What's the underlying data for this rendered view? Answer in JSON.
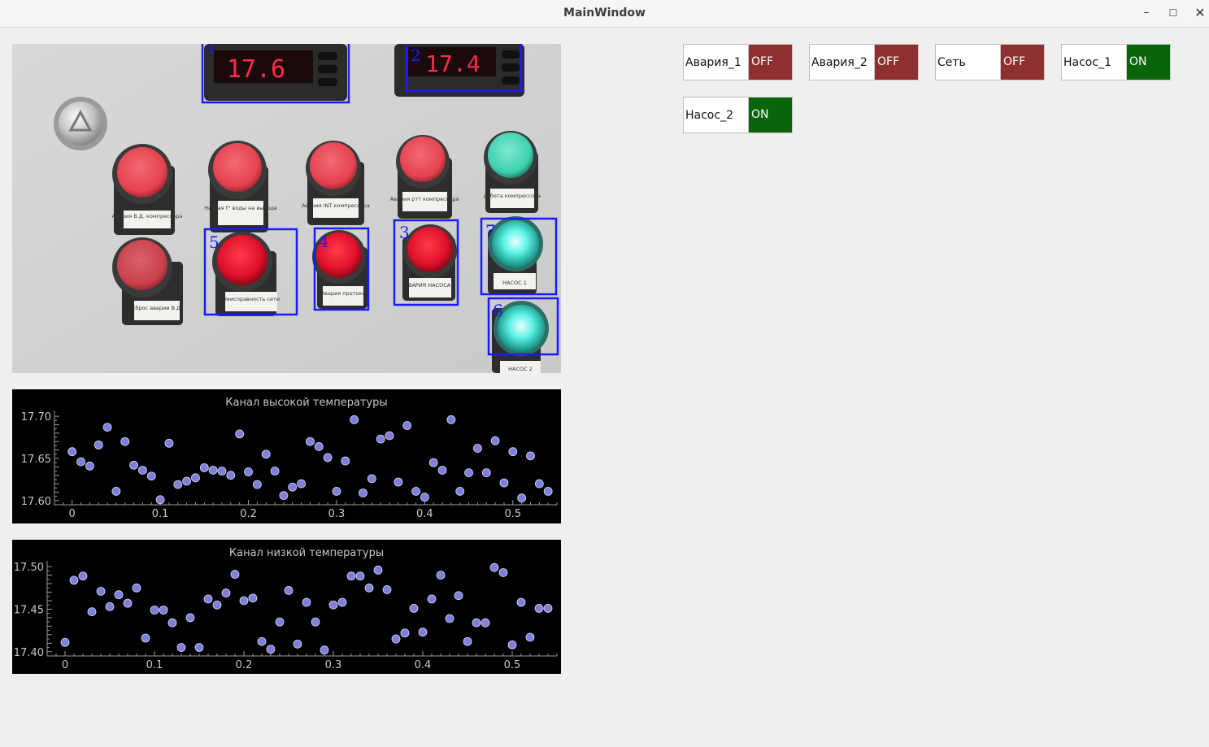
{
  "window": {
    "title": "MainWindow",
    "controls": {
      "minimize": "–",
      "maximize": "☐",
      "close": "✕"
    }
  },
  "camera": {
    "detections": [
      {
        "label": "1"
      },
      {
        "label": "2"
      },
      {
        "label": "3"
      },
      {
        "label": "4"
      },
      {
        "label": "5"
      },
      {
        "label": "6"
      },
      {
        "label": "7"
      }
    ],
    "display_readings": [
      "17.6",
      "17.4"
    ],
    "lamp_captions": [
      "Авария В.Д. компрессора",
      "Низкая t° воды на выходе",
      "Авария INT компрессора",
      "Авария ртт компрессора",
      "работа компрессора",
      "Сброс аварии В.Д.",
      "Неисправность сети",
      "Авария протока",
      "АВАРИЯ НАСОСА 1",
      "НАСОС 1",
      "НАСОС 2"
    ]
  },
  "statuses": [
    {
      "name": "Авария_1",
      "state": "OFF",
      "color": "#8f2f2f"
    },
    {
      "name": "Авария_2",
      "state": "OFF",
      "color": "#8f2f2f"
    },
    {
      "name": "Сеть",
      "state": "OFF",
      "color": "#8f2f2f"
    },
    {
      "name": "Насос_1",
      "state": "ON",
      "color": "#0a640a"
    },
    {
      "name": "Насос_2",
      "state": "ON",
      "color": "#0a640a"
    }
  ],
  "chart_data": [
    {
      "type": "scatter",
      "title": "Канал высокой температуры",
      "xlabel": "",
      "ylabel": "",
      "xlim": [
        -0.02,
        0.55
      ],
      "ylim": [
        17.595,
        17.703
      ],
      "xticks": [
        "0",
        "0.1",
        "0.2",
        "0.3",
        "0.4",
        "0.5"
      ],
      "yticks": [
        "17.60",
        "17.65",
        "17.70"
      ],
      "marker_color": "#7e7fd8",
      "x": [
        0,
        0.01,
        0.02,
        0.03,
        0.04,
        0.05,
        0.06,
        0.07,
        0.08,
        0.09,
        0.1,
        0.11,
        0.12,
        0.13,
        0.14,
        0.15,
        0.16,
        0.17,
        0.18,
        0.19,
        0.2,
        0.21,
        0.22,
        0.23,
        0.24,
        0.25,
        0.26,
        0.27,
        0.28,
        0.29,
        0.3,
        0.31,
        0.32,
        0.33,
        0.34,
        0.35,
        0.36,
        0.37,
        0.38,
        0.39,
        0.4,
        0.41,
        0.42,
        0.43,
        0.44,
        0.45,
        0.46,
        0.47,
        0.48,
        0.49,
        0.5,
        0.51,
        0.52,
        0.53,
        0.54
      ],
      "y": [
        17.658,
        17.646,
        17.641,
        17.666,
        17.687,
        17.611,
        17.67,
        17.642,
        17.636,
        17.629,
        17.601,
        17.668,
        17.619,
        17.623,
        17.627,
        17.639,
        17.636,
        17.635,
        17.63,
        17.679,
        17.634,
        17.619,
        17.655,
        17.635,
        17.606,
        17.616,
        17.62,
        17.67,
        17.664,
        17.651,
        17.611,
        17.647,
        17.696,
        17.609,
        17.626,
        17.673,
        17.677,
        17.622,
        17.689,
        17.611,
        17.604,
        17.645,
        17.636,
        17.696,
        17.611,
        17.633,
        17.662,
        17.633,
        17.671,
        17.621,
        17.658,
        17.603,
        17.653,
        17.62,
        17.611
      ]
    },
    {
      "type": "scatter",
      "title": "Канал низкой температуры",
      "xlabel": "",
      "ylabel": "",
      "xlim": [
        -0.02,
        0.55
      ],
      "ylim": [
        17.395,
        17.503
      ],
      "xticks": [
        "0",
        "0.1",
        "0.2",
        "0.3",
        "0.4",
        "0.5"
      ],
      "yticks": [
        "17.40",
        "17.45",
        "17.50"
      ],
      "marker_color": "#7e7fd8",
      "x": [
        0,
        0.01,
        0.02,
        0.03,
        0.04,
        0.05,
        0.06,
        0.07,
        0.08,
        0.09,
        0.1,
        0.11,
        0.12,
        0.13,
        0.14,
        0.15,
        0.16,
        0.17,
        0.18,
        0.19,
        0.2,
        0.21,
        0.22,
        0.23,
        0.24,
        0.25,
        0.26,
        0.27,
        0.28,
        0.29,
        0.3,
        0.31,
        0.32,
        0.33,
        0.34,
        0.35,
        0.36,
        0.37,
        0.38,
        0.39,
        0.4,
        0.41,
        0.42,
        0.43,
        0.44,
        0.45,
        0.46,
        0.47,
        0.48,
        0.49,
        0.5,
        0.51,
        0.52,
        0.53,
        0.54
      ],
      "y": [
        17.411,
        17.484,
        17.489,
        17.447,
        17.471,
        17.453,
        17.467,
        17.457,
        17.475,
        17.416,
        17.449,
        17.449,
        17.434,
        17.405,
        17.44,
        17.405,
        17.462,
        17.455,
        17.469,
        17.491,
        17.46,
        17.463,
        17.412,
        17.403,
        17.435,
        17.472,
        17.409,
        17.458,
        17.435,
        17.402,
        17.455,
        17.458,
        17.489,
        17.489,
        17.475,
        17.496,
        17.473,
        17.415,
        17.422,
        17.451,
        17.423,
        17.462,
        17.49,
        17.439,
        17.466,
        17.412,
        17.434,
        17.434,
        17.499,
        17.493,
        17.408,
        17.458,
        17.417,
        17.451,
        17.451
      ]
    }
  ]
}
